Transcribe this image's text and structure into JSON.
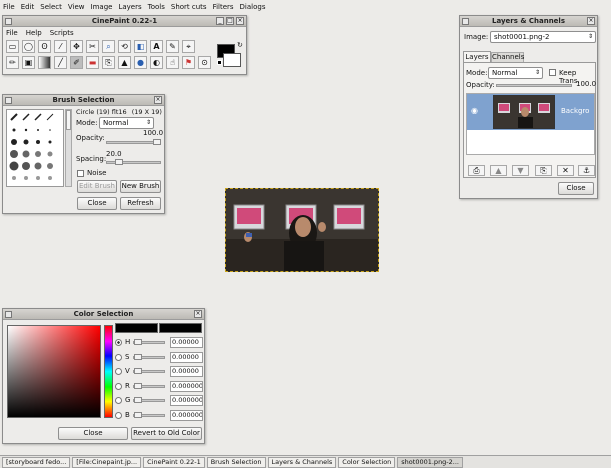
{
  "menubar": [
    "File",
    "Edit",
    "Select",
    "View",
    "Image",
    "Layers",
    "Tools",
    "Short cuts",
    "Filters",
    "Dialogs"
  ],
  "toolbox": {
    "title": "CinePaint 0.22-1",
    "menu": [
      "File",
      "Help",
      "Scripts"
    ],
    "tools_row1": [
      "rect-select-icon",
      "ellipse-select-icon",
      "lasso-icon",
      "magic-wand-icon",
      "move-icon",
      "crop-icon",
      "zoom-icon",
      "transform-icon",
      "flip-icon",
      "text-icon",
      "color-picker-icon"
    ],
    "tools_row2": [
      "clone-icon",
      "bucket-fill-icon",
      "blend-icon",
      "pencil-icon",
      "paintbrush-icon",
      "eraser-icon",
      "airbrush-icon",
      "smudge-icon",
      "ink-icon",
      "dodge-icon",
      "measure-icon",
      "clone-stamp-icon",
      "convolve-icon"
    ],
    "fg_color": "#000000",
    "bg_color": "#ffffff"
  },
  "brush": {
    "title": "Brush Selection",
    "brush_name": "Circle (19) flt16",
    "brush_size": "(19 X 19)",
    "mode_label": "Mode:",
    "mode_value": "Normal",
    "opacity_label": "Opacity:",
    "opacity_value": "100.0",
    "opacity_fraction": 1.0,
    "spacing_label": "Spacing:",
    "spacing_value": "20.0",
    "spacing_fraction": 0.2,
    "noise_label": "Noise",
    "edit_brush": "Edit Brush",
    "new_brush": "New Brush",
    "close": "Close",
    "refresh": "Refresh"
  },
  "layers": {
    "title": "Layers & Channels",
    "image_label": "Image:",
    "image_value": "shot0001.png-2",
    "tab_layers": "Layers",
    "tab_channels": "Channels",
    "mode_label": "Mode:",
    "mode_value": "Normal",
    "keep_trans": "Keep Trans.",
    "opacity_label": "Opacity:",
    "opacity_value": "100.0",
    "layer_name": "Backgro",
    "close": "Close"
  },
  "color": {
    "title": "Color Selection",
    "channels": [
      {
        "label": "H",
        "value": "0.00000",
        "selected": true
      },
      {
        "label": "S",
        "value": "0.00000",
        "selected": false
      },
      {
        "label": "V",
        "value": "0.00000",
        "selected": false
      },
      {
        "label": "R",
        "value": "0.000000",
        "selected": false
      },
      {
        "label": "G",
        "value": "0.000000",
        "selected": false
      },
      {
        "label": "B",
        "value": "0.000000",
        "selected": false
      }
    ],
    "close": "Close",
    "revert": "Revert to Old Color"
  },
  "taskbar": [
    {
      "label": "[storyboard fedo...",
      "active": false
    },
    {
      "label": "[File:Cinepaint.jp...",
      "active": false
    },
    {
      "label": "CinePaint 0.22-1",
      "active": false
    },
    {
      "label": "Brush Selection",
      "active": false
    },
    {
      "label": "Layers & Channels",
      "active": false
    },
    {
      "label": "Color Selection",
      "active": false
    },
    {
      "label": "shot0001.png-2...",
      "active": true
    }
  ]
}
